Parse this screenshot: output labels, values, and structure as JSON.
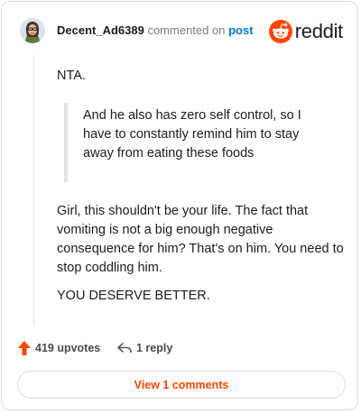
{
  "header": {
    "username": "Decent_Ad6389",
    "meta_text": "commented on",
    "post_link": "post",
    "logo_text": "reddit"
  },
  "comment": {
    "paragraph_1": "NTA.",
    "quote": "And he also has zero self control, so I have to constantly remind him to stay away from eating these foods",
    "paragraph_2": "Girl, this shouldn't be your life. The fact that vomiting is not a big enough negative consequence for him? That's on him. You need to stop coddling him.",
    "paragraph_3": "YOU DESERVE BETTER."
  },
  "actions": {
    "upvotes": "419 upvotes",
    "replies": "1 reply"
  },
  "footer": {
    "view_comments": "View 1 comments"
  },
  "colors": {
    "brand": "#ff4500",
    "link": "#0079d3"
  },
  "icons": [
    "avatar",
    "reddit-logo-icon",
    "upvote-arrow-icon",
    "reply-arrow-icon"
  ]
}
